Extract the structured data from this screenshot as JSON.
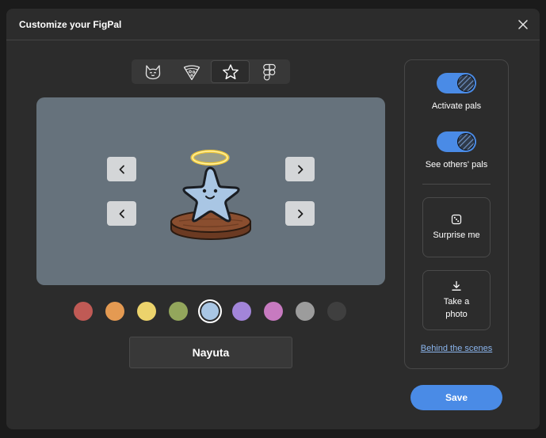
{
  "dialog": {
    "title": "Customize your FigPal",
    "close_icon": "close-icon"
  },
  "tabs": [
    {
      "icon": "cat-icon",
      "active": false
    },
    {
      "icon": "pizza-icon",
      "active": false
    },
    {
      "icon": "star-icon",
      "active": true
    },
    {
      "icon": "figma-logo-icon",
      "active": false
    }
  ],
  "stage": {
    "pal": "star-with-halo",
    "arrows": [
      "chevron-left-icon",
      "chevron-right-icon",
      "chevron-left-icon",
      "chevron-right-icon"
    ]
  },
  "colors": {
    "swatches": [
      "#c05a55",
      "#e49a52",
      "#ecd36c",
      "#93a65c",
      "#a9c6e4",
      "#a285d9",
      "#c77ac0",
      "#9c9c9c",
      "#3f3f3f"
    ],
    "selected_index": 4
  },
  "name_field": {
    "value": "Nayuta"
  },
  "panel": {
    "activate_label": "Activate pals",
    "activate_on": true,
    "others_label": "See others' pals",
    "others_on": true,
    "surprise_label": "Surprise me",
    "photo_label_line1": "Take a",
    "photo_label_line2": "photo",
    "behind_link": "Behind the scenes"
  },
  "footer": {
    "save_label": "Save"
  },
  "theme": {
    "accent": "#4a8be6",
    "background": "#2c2c2c"
  }
}
